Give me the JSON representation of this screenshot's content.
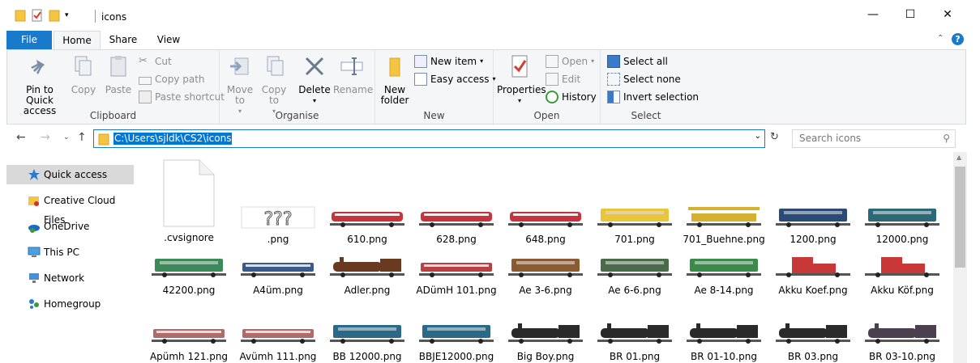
{
  "window": {
    "title": "icons",
    "minimize": "—",
    "maximize": "☐",
    "close": "✕"
  },
  "tabs": {
    "file": "File",
    "home": "Home",
    "share": "Share",
    "view": "View"
  },
  "ribbon": {
    "clipboard": {
      "label": "Clipboard",
      "pin": "Pin to Quick access",
      "copy": "Copy",
      "paste": "Paste",
      "cut": "Cut",
      "copy_path": "Copy path",
      "paste_shortcut": "Paste shortcut"
    },
    "organise": {
      "label": "Organise",
      "move_to": "Move to",
      "copy_to": "Copy to",
      "delete": "Delete",
      "rename": "Rename"
    },
    "new": {
      "label": "New",
      "new_folder": "New folder",
      "new_item": "New item",
      "easy_access": "Easy access"
    },
    "open": {
      "label": "Open",
      "properties": "Properties",
      "open": "Open",
      "edit": "Edit",
      "history": "History"
    },
    "select": {
      "label": "Select",
      "select_all": "Select all",
      "select_none": "Select none",
      "invert": "Invert selection"
    }
  },
  "address": {
    "path": "C:\\Users\\sjldk\\CS2\\icons",
    "search_placeholder": "Search icons"
  },
  "sidebar": [
    {
      "label": "Quick access",
      "icon": "star-icon"
    },
    {
      "label": "Creative Cloud Files",
      "icon": "cc-folder-icon"
    },
    {
      "label": "OneDrive",
      "icon": "onedrive-icon"
    },
    {
      "label": "This PC",
      "icon": "computer-icon"
    },
    {
      "label": "Network",
      "icon": "network-icon"
    },
    {
      "label": "Homegroup",
      "icon": "homegroup-icon"
    }
  ],
  "files": [
    {
      "name": ".cvsignore",
      "kind": "doc"
    },
    {
      "name": ".png",
      "kind": "unknown",
      "text": "???"
    },
    {
      "name": "610.png",
      "color": "#c8323c",
      "kind": "train"
    },
    {
      "name": "628.png",
      "color": "#c8323c",
      "kind": "train"
    },
    {
      "name": "648.png",
      "color": "#c8323c",
      "kind": "train"
    },
    {
      "name": "701.png",
      "color": "#e8c53a",
      "kind": "loco"
    },
    {
      "name": "701_Buehne.png",
      "color": "#d8b030",
      "kind": "crane"
    },
    {
      "name": "1200.png",
      "color": "#2a4a78",
      "kind": "loco"
    },
    {
      "name": "12000.png",
      "color": "#2a6a78",
      "kind": "loco"
    },
    {
      "name": "42200.png",
      "color": "#3a8a5a",
      "kind": "loco"
    },
    {
      "name": "A4üm.png",
      "color": "#3a5a8a",
      "kind": "coach"
    },
    {
      "name": "Adler.png",
      "color": "#6a3a20",
      "kind": "steam"
    },
    {
      "name": "ADümH 101.png",
      "color": "#b84040",
      "kind": "coach"
    },
    {
      "name": "Ae 3-6.png",
      "color": "#8a5a30",
      "kind": "loco"
    },
    {
      "name": "Ae 6-6.png",
      "color": "#4a6a4a",
      "kind": "loco"
    },
    {
      "name": "Ae 8-14.png",
      "color": "#3a8a4a",
      "kind": "loco"
    },
    {
      "name": "Akku Koef.png",
      "color": "#c83838",
      "kind": "small"
    },
    {
      "name": "Akku Köf.png",
      "color": "#c83838",
      "kind": "small"
    },
    {
      "name": "Apümh 121.png",
      "color": "#b06a6a",
      "kind": "coach"
    },
    {
      "name": "Avümh 111.png",
      "color": "#b06a6a",
      "kind": "coach"
    },
    {
      "name": "BB 12000.png",
      "color": "#2a6a88",
      "kind": "loco"
    },
    {
      "name": "BBJE12000.png",
      "color": "#2a6a88",
      "kind": "loco"
    },
    {
      "name": "Big Boy.png",
      "color": "#2a2a2a",
      "kind": "steam"
    },
    {
      "name": "BR 01.png",
      "color": "#2a2a2a",
      "kind": "steam"
    },
    {
      "name": "BR 01-10.png",
      "color": "#2a2a2a",
      "kind": "steam"
    },
    {
      "name": "BR 03.png",
      "color": "#2a2a2a",
      "kind": "steam"
    },
    {
      "name": "BR 03-10.png",
      "color": "#4a4050",
      "kind": "steam"
    }
  ]
}
